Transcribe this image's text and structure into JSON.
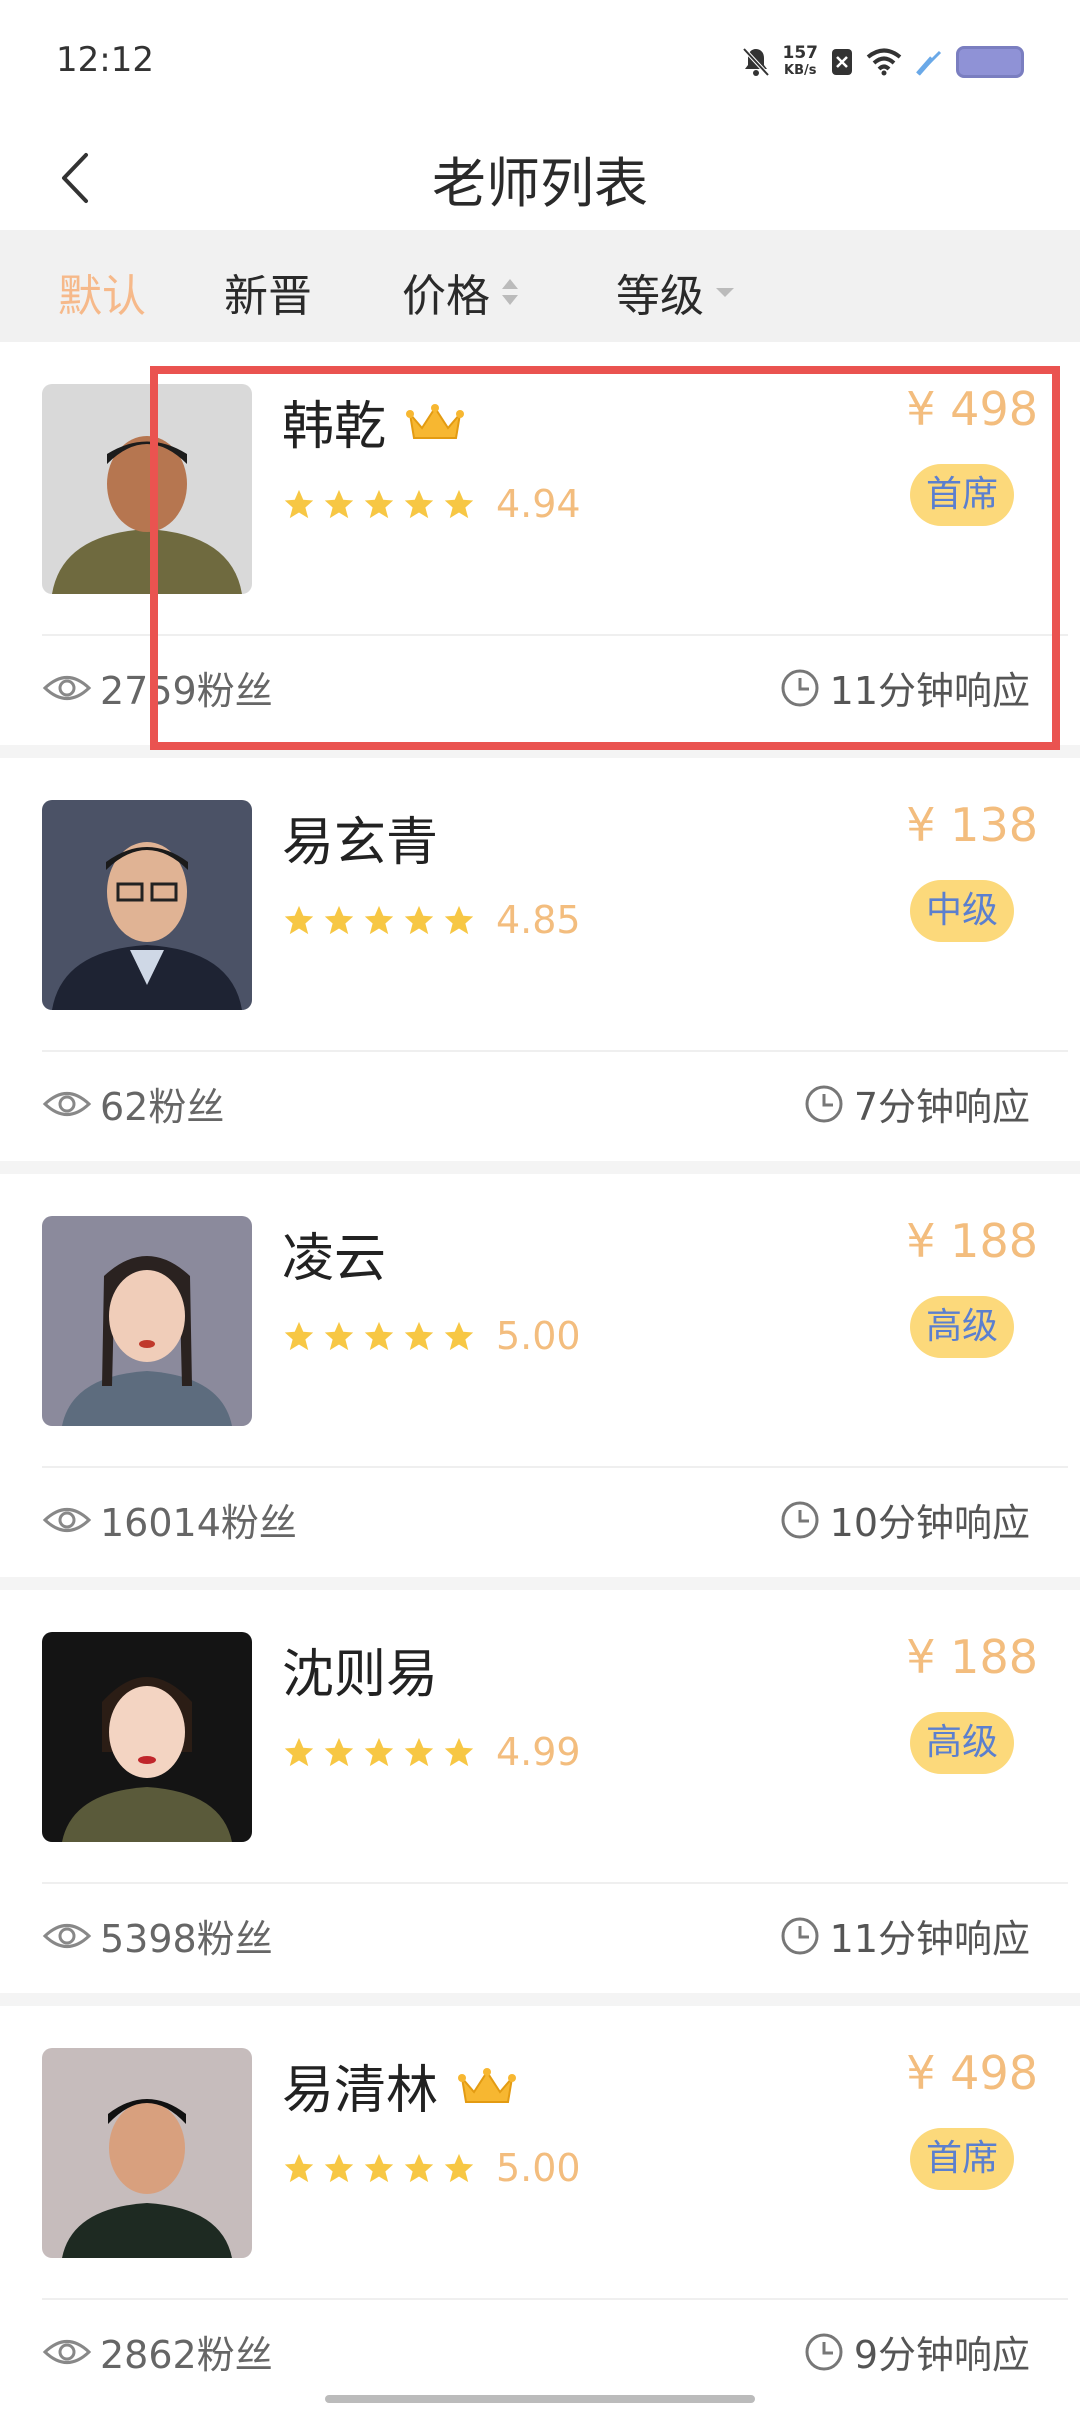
{
  "status_bar": {
    "time": "12:12",
    "speed_value": "157",
    "speed_unit": "KB/s"
  },
  "header": {
    "title": "老师列表"
  },
  "filters": [
    {
      "label": "默认",
      "active": true
    },
    {
      "label": "新晋"
    },
    {
      "label": "价格"
    },
    {
      "label": "等级"
    }
  ],
  "teachers": [
    {
      "name": "韩乾",
      "crown": true,
      "rating": "4.94",
      "stars_shown": 4.94,
      "price": "¥ 498",
      "level": "首席",
      "fans": "2759粉丝",
      "response": "11分钟响应"
    },
    {
      "name": "易玄青",
      "crown": false,
      "rating": "4.85",
      "stars_shown": 4.85,
      "price": "¥ 138",
      "level": "中级",
      "fans": "62粉丝",
      "response": "7分钟响应"
    },
    {
      "name": "凌云",
      "crown": false,
      "rating": "5.00",
      "stars_shown": 5.0,
      "price": "¥ 188",
      "level": "高级",
      "fans": "16014粉丝",
      "response": "10分钟响应"
    },
    {
      "name": "沈则易",
      "crown": false,
      "rating": "4.99",
      "stars_shown": 4.99,
      "price": "¥ 188",
      "level": "高级",
      "fans": "5398粉丝",
      "response": "11分钟响应"
    },
    {
      "name": "易清林",
      "crown": true,
      "rating": "5.00",
      "stars_shown": 5.0,
      "price": "¥ 498",
      "level": "首席",
      "fans": "2862粉丝",
      "response": "9分钟响应"
    }
  ],
  "colors": {
    "accent": "#f3bd7e",
    "badge_bg": "#fcd97b",
    "badge_text": "#5b7fcf",
    "highlight": "#ea5350"
  },
  "icons": [
    "back-arrow-icon",
    "crown-icon",
    "star-icon",
    "eye-icon",
    "clock-icon",
    "sort-arrows-icon",
    "dropdown-arrow-icon"
  ]
}
